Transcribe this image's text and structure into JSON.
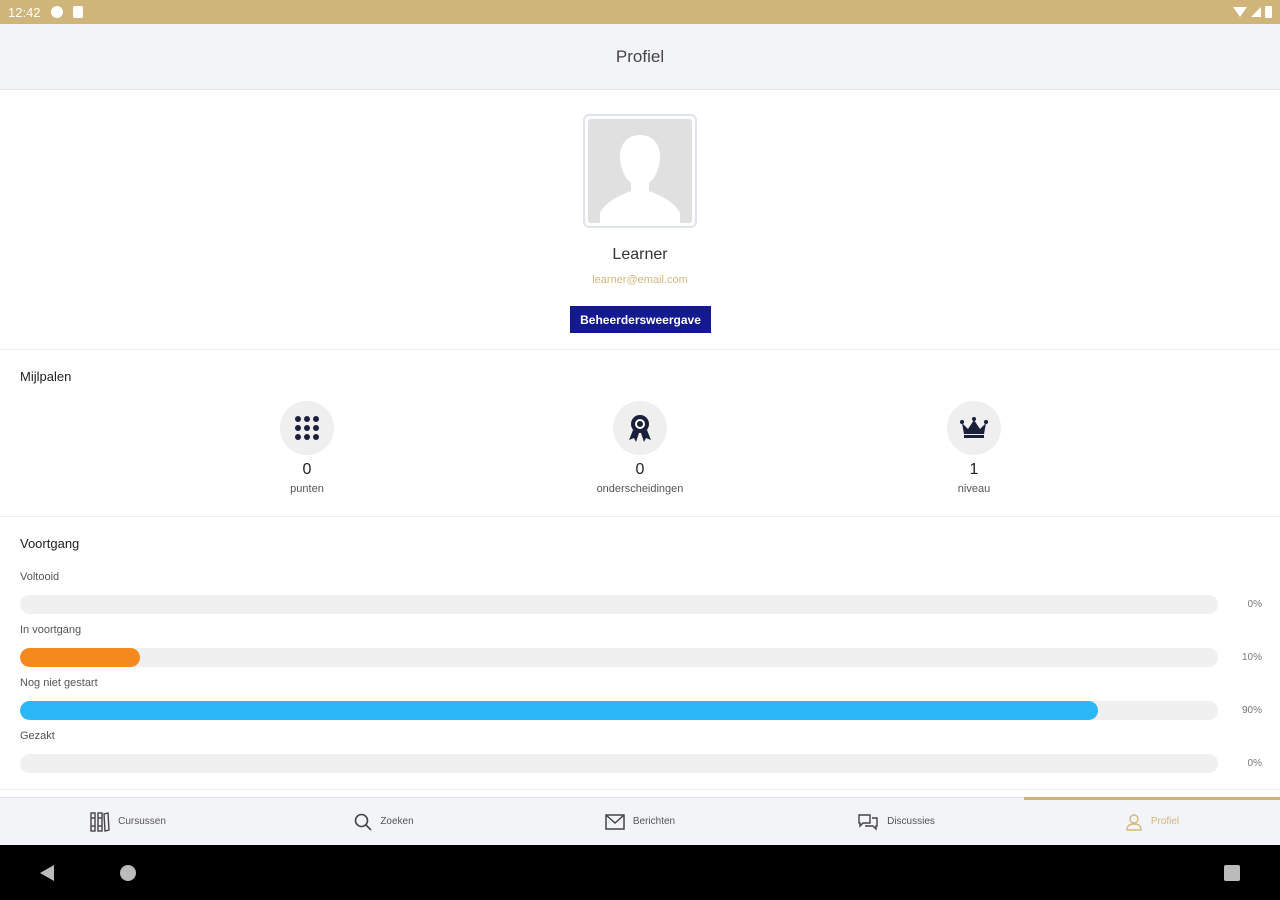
{
  "status_bar": {
    "time": "12:42"
  },
  "header": {
    "title": "Profiel"
  },
  "profile": {
    "name": "Learner",
    "email": "learner@email.com",
    "admin_button": "Beheerdersweergave"
  },
  "milestones": {
    "title": "Mijlpalen",
    "items": [
      {
        "count": "0",
        "label": "punten",
        "icon": "grid-icon"
      },
      {
        "count": "0",
        "label": "onderscheidingen",
        "icon": "award-icon"
      },
      {
        "count": "1",
        "label": "niveau",
        "icon": "crown-icon"
      }
    ]
  },
  "progress": {
    "title": "Voortgang",
    "rows": [
      {
        "label": "Voltooid",
        "value": "0%",
        "percent": 0,
        "color": "#f5891e"
      },
      {
        "label": "In voortgang",
        "value": "10%",
        "percent": 10,
        "color": "#f5891e"
      },
      {
        "label": "Nog niet gestart",
        "value": "90%",
        "percent": 90,
        "color": "#2bb6f5"
      },
      {
        "label": "Gezakt",
        "value": "0%",
        "percent": 0,
        "color": "#e53935"
      }
    ]
  },
  "tabs": [
    {
      "label": "Cursussen",
      "icon": "courses-icon",
      "active": false
    },
    {
      "label": "Zoeken",
      "icon": "search-icon",
      "active": false
    },
    {
      "label": "Berichten",
      "icon": "mail-icon",
      "active": false
    },
    {
      "label": "Discussies",
      "icon": "chat-icon",
      "active": false
    },
    {
      "label": "Profiel",
      "icon": "user-icon",
      "active": true
    }
  ],
  "colors": {
    "accent": "#cfb57a",
    "admin_button": "#14198f",
    "in_progress": "#f5891e",
    "not_started": "#2bb6f5"
  }
}
